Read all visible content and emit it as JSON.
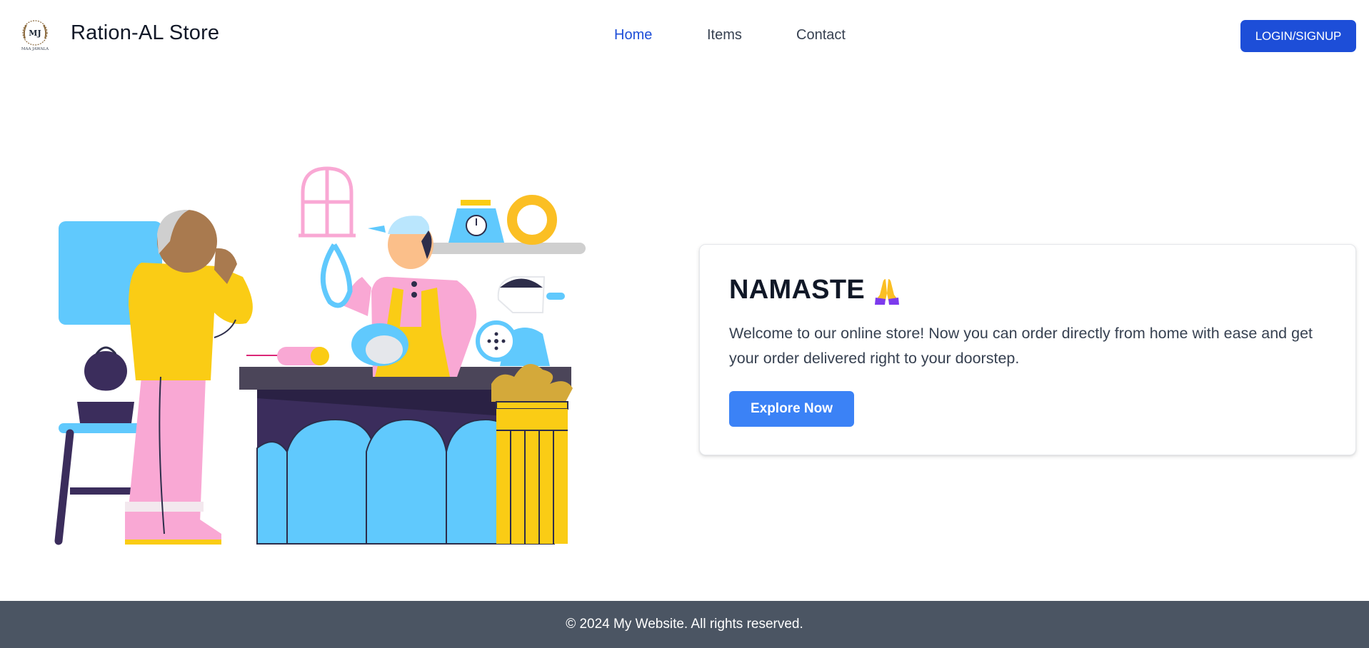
{
  "header": {
    "brand": "Ration-AL Store",
    "logo_icon": "laurel-wreath-logo",
    "logo_caption": "MAA JAWALA",
    "nav": [
      {
        "label": "Home",
        "active": true
      },
      {
        "label": "Items",
        "active": false
      },
      {
        "label": "Contact",
        "active": false
      }
    ],
    "login_label": "LOGIN/SIGNUP"
  },
  "hero": {
    "illustration": "kitchen-shop-illustration",
    "card": {
      "title": "NAMASTE",
      "title_icon": "folded-hands-icon",
      "text": "Welcome to our online store! Now you can order directly from home with ease and get your order delivered right to your doorstep.",
      "cta_label": "Explore Now"
    }
  },
  "footer": {
    "text": "© 2024 My Website. All rights reserved."
  },
  "colors": {
    "primary": "#1d4ed8",
    "cta": "#3b82f6",
    "footer_bg": "#4b5563"
  }
}
